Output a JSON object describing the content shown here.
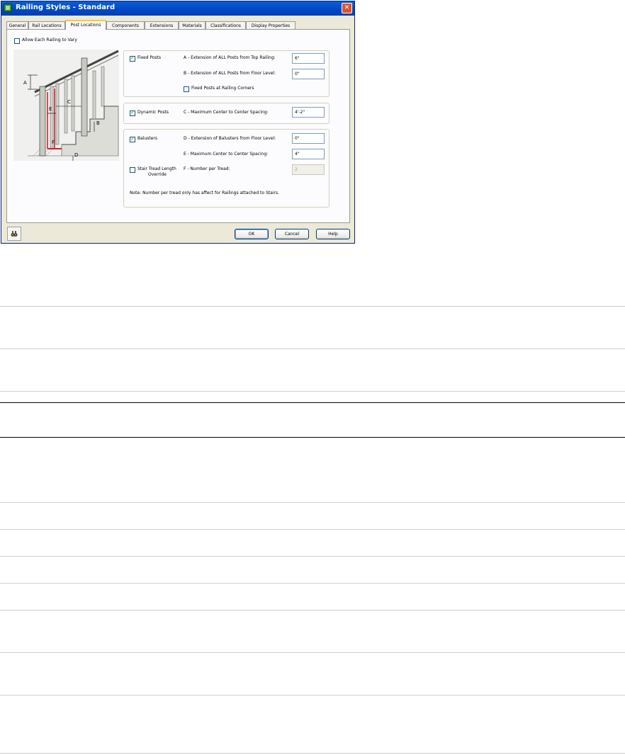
{
  "window": {
    "title": "Railing Styles - Standard",
    "close_label": "✕"
  },
  "tabs": [
    {
      "label": "General"
    },
    {
      "label": "Rail Locations"
    },
    {
      "label": "Post Locations"
    },
    {
      "label": "Components"
    },
    {
      "label": "Extensions"
    },
    {
      "label": "Materials"
    },
    {
      "label": "Classifications"
    },
    {
      "label": "Display Properties"
    }
  ],
  "active_tab": "Post Locations",
  "allow_vary": {
    "label": "Allow Each Railing to Vary",
    "checked": false
  },
  "diagram": {
    "labels": [
      "A",
      "B",
      "C",
      "D",
      "E",
      "F"
    ]
  },
  "fixed_posts": {
    "label": "Fixed Posts",
    "checked": true,
    "a_label": "A - Extension of ALL Posts from Top Railing:",
    "a_value": "6\"",
    "b_label": "B - Extension of ALL Posts from Floor Level:",
    "b_value": "0\"",
    "corners_label": "Fixed Posts at Railing Corners",
    "corners_checked": false
  },
  "dynamic_posts": {
    "label": "Dynamic Posts",
    "checked": true,
    "c_label": "C - Maximum Center to Center Spacing:",
    "c_value": "4'-2\""
  },
  "balusters": {
    "label": "Balusters",
    "checked": true,
    "d_label": "D - Extension of Balusters from Floor Level:",
    "d_value": "0\"",
    "e_label": "E - Maximum Center to Center Spacing:",
    "e_value": "4\"",
    "override_label_1": "Stair Tread Length",
    "override_label_2": "Override",
    "override_checked": false,
    "f_label": "F - Number per Tread:",
    "f_value": "2",
    "note": "Note: Number per tread only has affect for Railings attached to Stairs."
  },
  "buttons": {
    "ok": "OK",
    "cancel": "Cancel",
    "help": "Help"
  }
}
